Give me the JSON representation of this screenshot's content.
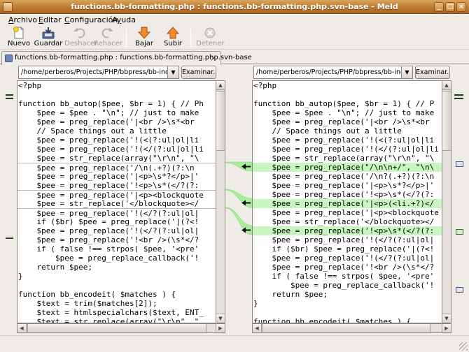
{
  "window": {
    "title": "functions.bb-formatting.php : functions.bb-formatting.php.svn-base - Meld",
    "controls": {
      "minimize": "_",
      "maximize": "□",
      "close": "×"
    }
  },
  "menu": {
    "items": [
      {
        "label": "Archivo",
        "mnemonic": "A",
        "rest": "rchivo"
      },
      {
        "label": "Editar",
        "mnemonic": "E",
        "rest": "ditar"
      },
      {
        "label": "Configuración",
        "mnemonic": "C",
        "rest": "onfiguración"
      },
      {
        "label": "Ayuda",
        "mnemonic": "y",
        "rest": "uda",
        "prefix": "A"
      }
    ]
  },
  "toolbar": {
    "new_label": "Nuevo",
    "save_label": "Guardar",
    "undo_label": "Deshacer",
    "redo_label": "Rehacer",
    "down_label": "Bajar",
    "up_label": "Subir",
    "stop_label": "Detener"
  },
  "tab": {
    "label": "functions.bb-formatting.php : functions.bb-formatting.php.svn-base",
    "close": "×"
  },
  "left": {
    "path": "/home/perberos/Projects/PHP/bbpress/bb-includes",
    "browse_label": "Examinar...",
    "lines": [
      "<?php",
      "",
      "function bb_autop($pee, $br = 1) { // Ph",
      "    $pee = $pee . \"\\n\"; // just to make",
      "    $pee = preg_replace('|<br />\\s*<br",
      "    // Space things out a little",
      "    $pee = preg_replace('!(<(?:ul|ol|li",
      "    $pee = preg_replace('!(</(?:ul|ol|li",
      "    $pee = str_replace(array(\"\\r\\n\", \"\\",
      "    $pee = preg_replace('/\\n(.+?)(?:\\n",
      "    $pee = preg_replace('|<p>\\s*?</p>|'",
      "    $pee = preg_replace('!<p>\\s*(</?(?:",
      "    $pee = preg_replace('|<p><blockquote",
      "    $pee = str_replace('</blockquote></",
      "    $pee = preg_replace('!(</?(?:ul|ol|",
      "    if ($br) $pee = preg_replace('|(?<!",
      "    $pee = preg_replace('!(</?(?:ul|ol|",
      "    $pee = preg_replace('!<br />(\\s*</?",
      "    if ( false !== strpos( $pee, '<pre'",
      "        $pee = preg_replace_callback('!",
      "    return $pee;",
      "}",
      "",
      "function bb_encodeit( $matches ) {",
      "    $text = trim($matches[2]);",
      "    $text = htmlspecialchars($text, ENT_",
      "    $text = str_replace(array(\"\\r\\n\", \""
    ]
  },
  "right": {
    "path": "/home/perberos/Projects/PHP/bbpress/bb-includes",
    "browse_label": "Examinar...",
    "lines": [
      "<?php",
      "",
      "function bb_autop($pee, $br = 1) { // P",
      "    $pee = $pee . \"\\n\"; // just to make",
      "    $pee = preg_replace('|<br />\\s*<br",
      "    // Space things out a little",
      "    $pee = preg_replace('!(<(?:ul|ol|li",
      "    $pee = preg_replace('!(</(?:ul|ol|li",
      "    $pee = str_replace(array(\"\\r\\n\", \"\\",
      "    $pee = preg_replace(\"/\\n\\n+/\", \"\\n\\",
      "    $pee = preg_replace('/\\n?(.+?)(?:\\n",
      "    $pee = preg_replace('|<p>\\s*?</p>|'",
      "    $pee = preg_replace('!<p>\\s*(</?(?:",
      "    $pee = preg_replace('|<p>(<li.+?)</",
      "    $pee = preg_replace('|<p><blockquote",
      "    $pee = str_replace('</blockquote></",
      "    $pee = preg_replace('!<p>\\s*(</?(?:",
      "    $pee = preg_replace('!(</?(?:ul|ol|",
      "    if ($br) $pee = preg_replace('|(?<!",
      "    $pee = preg_replace('!(</?(?:ul|ol|",
      "    $pee = preg_replace('!<br />(\\s*</?",
      "    if ( false !== strpos( $pee, '<pre'",
      "        $pee = preg_replace_callback('!",
      "    return $pee;",
      "}",
      "",
      "function bb_encodeit( $matches ) {"
    ]
  },
  "diff": {
    "right_changed_lines": [
      9,
      13,
      16
    ],
    "left_insert_after": [
      8,
      11,
      13
    ],
    "color_insert": "#c8f5c0",
    "color_insert_link": "#a9ee9d"
  },
  "colors": {
    "titlebar": "#b9762e",
    "window_bg": "#efebe7",
    "arrow_down": "#e8822a",
    "arrow_up": "#e8822a"
  }
}
